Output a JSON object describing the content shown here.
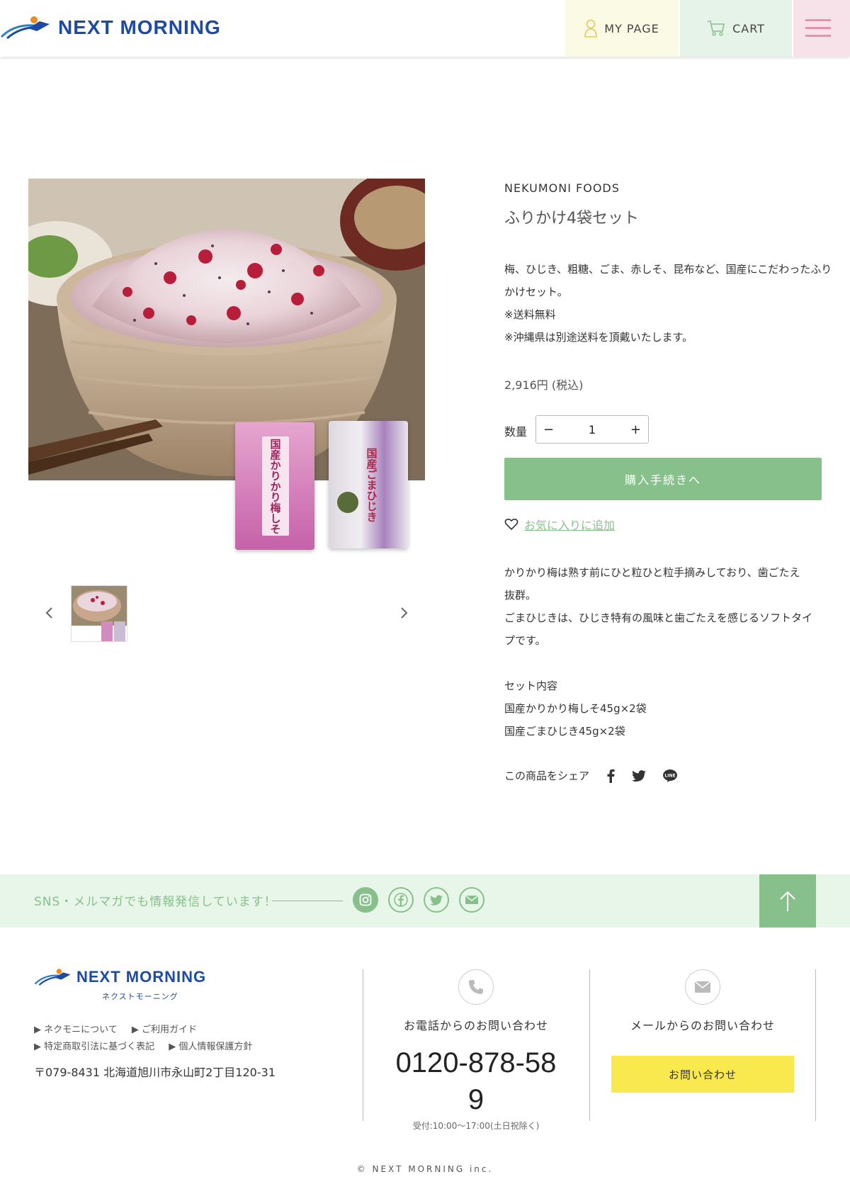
{
  "header": {
    "logo": "NEXT MORNING",
    "mypage_label": "MY PAGE",
    "cart_label": "CART"
  },
  "product": {
    "brand": "NEKUMONI FOODS",
    "title": "ふりかけ4袋セット",
    "desc_lines": [
      "梅、ひじき、粗糖、ごま、赤しそ、昆布など、国産にこだわったふり",
      "かけセット。",
      "※送料無料",
      "※沖縄県は別途送料を頂戴いたします。"
    ],
    "price": "2,916円 (税込)",
    "qty_label": "数量",
    "qty_minus": "−",
    "qty_value": "1",
    "qty_plus": "+",
    "buy_label": "購入手続きへ",
    "fav_label": "お気に入りに追加",
    "detail_lines": [
      "かりかり梅は熟す前にひと粒ひと粒手摘みしており、歯ごたえ",
      "抜群。",
      "ごまひじきは、ひじき特有の風味と歯ごたえを感じるソフトタイ",
      "プです。",
      "",
      "セット内容",
      "国産かりかり梅しそ45g×2袋",
      "国産ごまひじき45g×2袋"
    ],
    "share_label": "この商品をシェア",
    "pack1_text": "国産かりかり梅しそ",
    "pack2_text": "国産ごまひじき"
  },
  "sns": {
    "text": "SNS・メルマガでも情報発信しています！"
  },
  "footer": {
    "logo": "NEXT MORNING",
    "logo_sub": "ネクストモーニング",
    "links": [
      "▶ ネクモニについて",
      "▶ ご利用ガイド",
      "▶ 特定商取引法に基づく表記",
      "▶ 個人情報保護方針"
    ],
    "address": "〒079-8431 北海道旭川市永山町2丁目120-31",
    "tel_title": "お電話からのお問い合わせ",
    "tel_number": "0120-878-589",
    "tel_note": "受付:10:00〜17:00(土日祝除く)",
    "mail_title": "メールからのお問い合わせ",
    "mail_button": "お問い合わせ",
    "copyright": "© NEXT MORNING inc."
  },
  "colors": {
    "accent_green": "#88c08c",
    "brand_blue": "#1d4aa3",
    "mail_yellow": "#f9e84e"
  }
}
